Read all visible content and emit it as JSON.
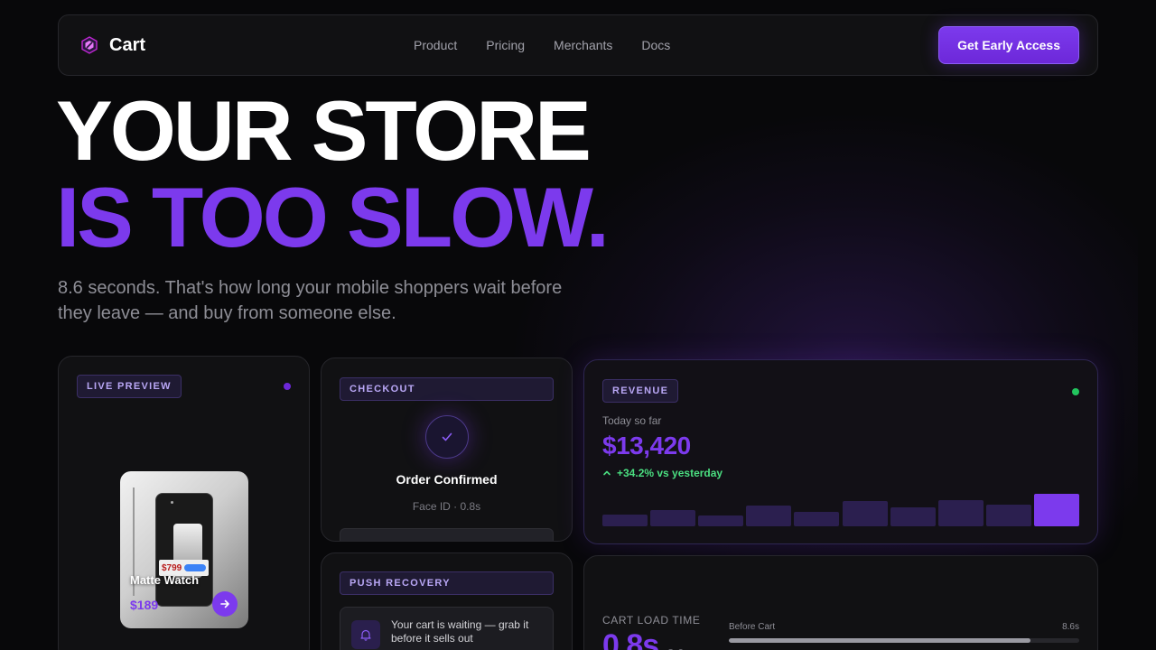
{
  "nav": {
    "brand": "Cart",
    "links": [
      "Product",
      "Pricing",
      "Merchants",
      "Docs"
    ],
    "cta": "Get Early Access"
  },
  "hero": {
    "line1": "YOUR STORE",
    "line2": "IS TOO SLOW.",
    "subtitle": "8.6 seconds. That's how long your mobile shoppers wait before they leave — and buy from someone else."
  },
  "live_preview": {
    "tag": "LIVE PREVIEW",
    "product_name": "Matte Watch",
    "price": "$189",
    "old_price": "$799"
  },
  "checkout": {
    "tag": "CHECKOUT",
    "title": "Order Confirmed",
    "subtitle": "Face ID · 0.8s"
  },
  "push": {
    "tag": "PUSH RECOVERY",
    "message": "Your cart is waiting — grab it before it sells out"
  },
  "revenue": {
    "tag": "REVENUE",
    "label": "Today so far",
    "value": "$13,420",
    "change": "+34.2% vs yesterday",
    "bars": [
      0.3,
      0.45,
      0.28,
      0.6,
      0.4,
      0.75,
      0.55,
      0.8,
      0.65,
      1.0
    ],
    "colors": {
      "accent": "#7c3aed",
      "bar": "#2b1f4f",
      "positive": "#4ade80"
    }
  },
  "load": {
    "label": "CART LOAD TIME",
    "value": "0.8s",
    "compare_name": "Before Cart",
    "compare_value": "8.6s",
    "compare_fill": 0.86
  },
  "colors": {
    "accent": "#7c3aed",
    "status_live": "#6d28d9",
    "status_ok": "#22c55e"
  }
}
